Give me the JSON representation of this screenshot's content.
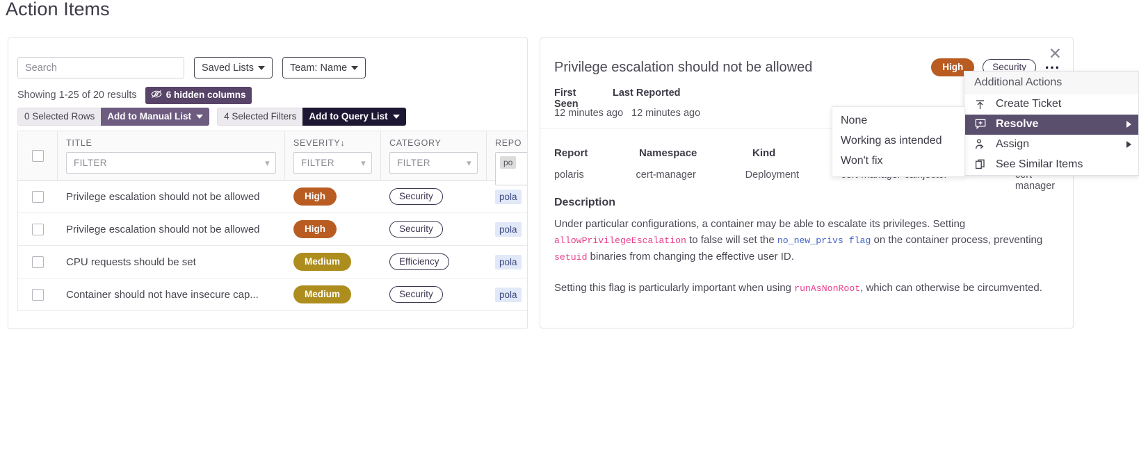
{
  "page": {
    "title": "Action Items"
  },
  "toolbar": {
    "search_placeholder": "Search",
    "saved_lists": "Saved Lists",
    "team_filter": "Team: Name",
    "showing": "Showing 1-25 of 20 results",
    "hidden_columns": "6 hidden columns",
    "hidden_columns_icon": "eye-slash-icon",
    "selected_rows": "0 Selected Rows",
    "add_to_manual_list": "Add to Manual List",
    "selected_filters": "4 Selected Filters",
    "add_to_query_list": "Add to Query List"
  },
  "table": {
    "columns": [
      {
        "label": "TITLE",
        "filter": "FILTER"
      },
      {
        "label": "SEVERITY↓",
        "filter": "FILTER"
      },
      {
        "label": "CATEGORY",
        "filter": "FILTER"
      },
      {
        "label": "REPO",
        "filter": "po"
      }
    ],
    "rows": [
      {
        "title": "Privilege escalation should not be allowed",
        "severity": "High",
        "category": "Security",
        "report": "pola"
      },
      {
        "title": "Privilege escalation should not be allowed",
        "severity": "High",
        "category": "Security",
        "report": "pola"
      },
      {
        "title": "CPU requests should be set",
        "severity": "Medium",
        "category": "Efficiency",
        "report": "pola"
      },
      {
        "title": "Container should not have insecure cap...",
        "severity": "Medium",
        "category": "Security",
        "report": "pola"
      }
    ]
  },
  "detail": {
    "title": "Privilege escalation should not be allowed",
    "severity_badge": "High",
    "category_badge": "Security",
    "more_icon": "ellipsis-icon",
    "close_icon": "close-icon",
    "first_seen_label": "First Seen",
    "last_reported_label": "Last Reported",
    "first_seen_value": "12 minutes ago",
    "last_reported_value": "12 minutes ago",
    "meta_headers": [
      "Report",
      "Namespace",
      "Kind",
      "",
      ""
    ],
    "meta_values": [
      "polaris",
      "cert-manager",
      "Deployment",
      "cert-manager-cainjector",
      "cert-manager"
    ],
    "description_heading": "Description",
    "description": {
      "p1_a": "Under particular configurations, a container may be able to escalate its privileges. Setting ",
      "p1_code1": "allowPrivilegeEscalation",
      "p1_b": " to false will set the ",
      "p1_code2": "no_new_privs flag",
      "p1_c": " on the container process, preventing ",
      "p1_code3": "setuid",
      "p1_d": " binaries from changing the effective user ID.",
      "p2_a": "Setting this flag is particularly important when using ",
      "p2_code1": "runAsNonRoot",
      "p2_b": ", which can otherwise be circumvented."
    }
  },
  "context_menu": {
    "header": "Additional Actions",
    "items": [
      {
        "label": "Create Ticket",
        "icon": "upload-arrow-icon",
        "has_submenu": false,
        "active": false
      },
      {
        "label": "Resolve",
        "icon": "resolve-plus-icon",
        "has_submenu": true,
        "active": true
      },
      {
        "label": "Assign",
        "icon": "person-assign-icon",
        "has_submenu": true,
        "active": false
      },
      {
        "label": "See Similar Items",
        "icon": "copy-items-icon",
        "has_submenu": false,
        "active": false
      }
    ]
  },
  "submenu": {
    "items": [
      {
        "label": "None"
      },
      {
        "label": "Working as intended"
      },
      {
        "label": "Won't fix"
      }
    ]
  },
  "colors": {
    "accent_purple": "#584468",
    "dark_navy": "#1e1733",
    "menu_highlight": "#5b4f6e",
    "severity_high": "#b85c22",
    "severity_medium": "#ad8d1d",
    "code_pink": "#e83e8c",
    "code_blue": "#4263c8"
  }
}
